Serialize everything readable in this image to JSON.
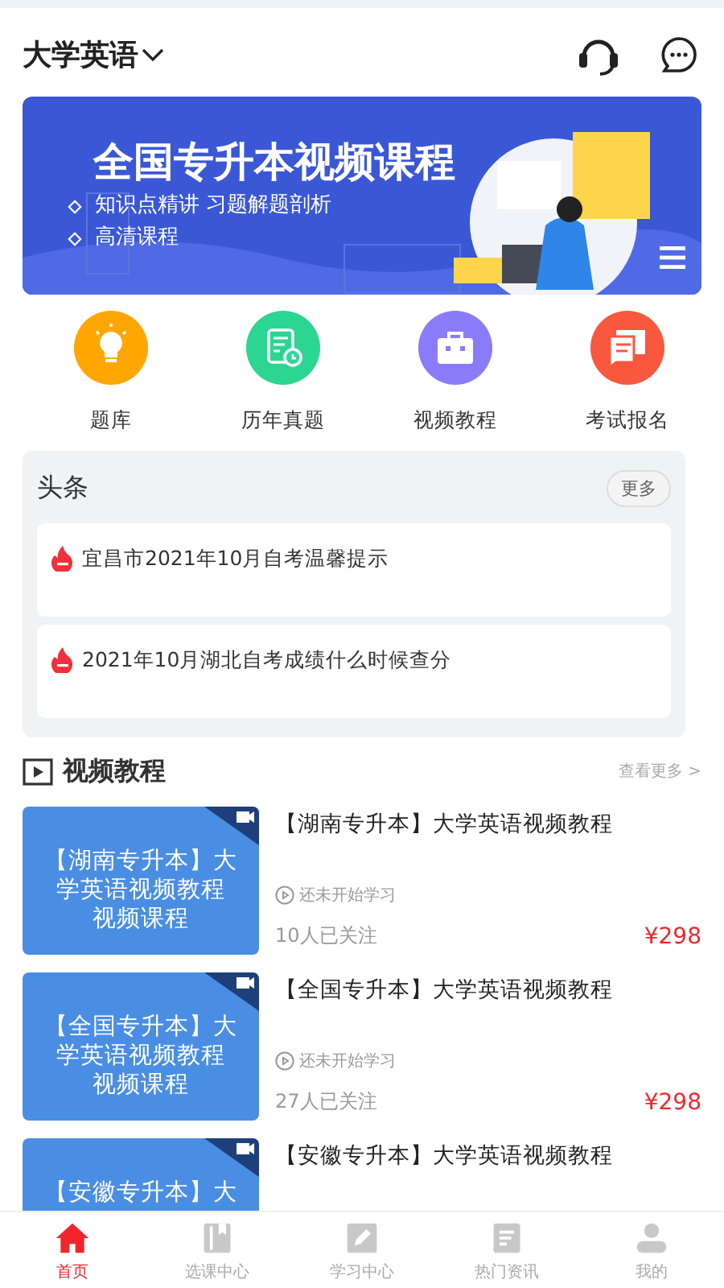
{
  "header": {
    "title": "大学英语"
  },
  "banner": {
    "title": "全国专升本视频课程",
    "points": [
      "知识点精讲 习题解题剖析",
      "高清课程"
    ]
  },
  "shortcuts": [
    {
      "label": "题库",
      "kind": "bulb",
      "color": "#ffa600"
    },
    {
      "label": "历年真题",
      "kind": "paper",
      "color": "#2bd690"
    },
    {
      "label": "视频教程",
      "kind": "bag",
      "color": "#8a7cf8"
    },
    {
      "label": "考试报名",
      "kind": "chat",
      "color": "#f9573e"
    }
  ],
  "headlines": {
    "title": "头条",
    "more": "更多",
    "items": [
      "宜昌市2021年10月自考温馨提示",
      "2021年10月湖北自考成绩什么时候查分"
    ]
  },
  "videos": {
    "title": "视频教程",
    "more": "查看更多 >",
    "items": [
      {
        "thumb_lines": [
          "【湖南专升本】大",
          "学英语视频教程",
          "视频课程"
        ],
        "title": "【湖南专升本】大学英语视频教程",
        "status": "还未开始学习",
        "followers": "10人已关注",
        "price": "¥298"
      },
      {
        "thumb_lines": [
          "【全国专升本】大",
          "学英语视频教程",
          "视频课程"
        ],
        "title": "【全国专升本】大学英语视频教程",
        "status": "还未开始学习",
        "followers": "27人已关注",
        "price": "¥298"
      },
      {
        "thumb_lines": [
          "【安徽专升本】大"
        ],
        "title": "【安徽专升本】大学英语视频教程"
      }
    ]
  },
  "tabbar": [
    {
      "label": "首页",
      "kind": "home",
      "selected": true
    },
    {
      "label": "选课中心",
      "kind": "book",
      "selected": false
    },
    {
      "label": "学习中心",
      "kind": "pen",
      "selected": false
    },
    {
      "label": "热门资讯",
      "kind": "news",
      "selected": false
    },
    {
      "label": "我的",
      "kind": "user",
      "selected": false
    }
  ]
}
